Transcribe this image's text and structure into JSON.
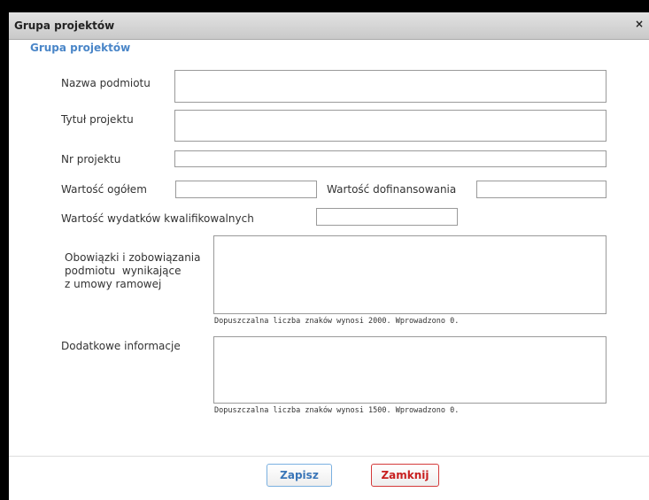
{
  "dialog": {
    "title": "Grupa projektów",
    "close_label": "×",
    "section_title": "Grupa projektów"
  },
  "form": {
    "nazwa_podmiotu": {
      "label": "Nazwa podmiotu",
      "value": ""
    },
    "tytul_projektu": {
      "label": "Tytuł projektu",
      "value": ""
    },
    "nr_projektu": {
      "label": "Nr projektu",
      "value": ""
    },
    "wartosc_ogolem": {
      "label": "Wartość ogółem",
      "value": ""
    },
    "wartosc_dofinansowania": {
      "label": "Wartość dofinansowania",
      "value": ""
    },
    "wartosc_wydatkow": {
      "label": "Wartość wydatków kwalifikowalnych",
      "value": ""
    },
    "obowiazki": {
      "label_lines": [
        "Obowiązki i zobowiązania",
        "podmiotu  wynikające",
        "z umowy ramowej"
      ],
      "value": "",
      "hint": "Dopuszczalna liczba znaków wynosi 2000. Wprowadzono 0."
    },
    "dodatkowe": {
      "label": "Dodatkowe informacje",
      "value": "",
      "hint": "Dopuszczalna liczba znaków wynosi 1500. Wprowadzono 0."
    }
  },
  "buttons": {
    "save": "Zapisz",
    "close": "Zamknij"
  }
}
